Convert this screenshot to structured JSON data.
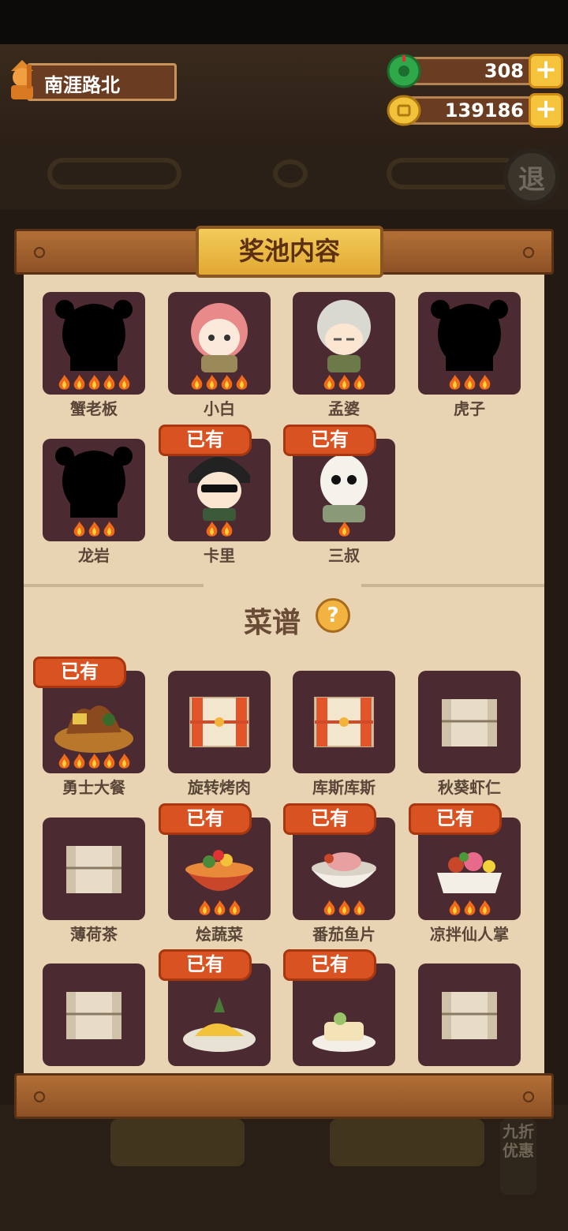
{
  "player": {
    "name": "南涯路北"
  },
  "resources": [
    {
      "icon": "jade-icon",
      "value": "308",
      "color": "#2fa84a"
    },
    {
      "icon": "coin-icon",
      "value": "139186",
      "color": "#f2c23a"
    }
  ],
  "scene": {
    "exit_label": "退",
    "discount_label": "九折优惠"
  },
  "modal": {
    "title": "奖池内容",
    "recipe_section": "菜谱",
    "help_symbol": "?"
  },
  "owned_label": "已有",
  "characters": [
    {
      "name": "蟹老板",
      "owned": false,
      "flames": 5,
      "art": "silhouette-icon"
    },
    {
      "name": "小白",
      "owned": false,
      "flames": 4,
      "art": "girl-portrait-icon"
    },
    {
      "name": "孟婆",
      "owned": false,
      "flames": 3,
      "art": "grandma-portrait-icon"
    },
    {
      "name": "虎子",
      "owned": false,
      "flames": 3,
      "art": "silhouette-icon"
    },
    {
      "name": "龙岩",
      "owned": false,
      "flames": 3,
      "art": "silhouette-icon"
    },
    {
      "name": "卡里",
      "owned": true,
      "flames": 2,
      "art": "sunglasses-boy-icon"
    },
    {
      "name": "三叔",
      "owned": true,
      "flames": 1,
      "art": "uncle-portrait-icon"
    }
  ],
  "recipes": [
    {
      "name": "勇士大餐",
      "owned": true,
      "flames": 5,
      "art": "feast-dish-icon"
    },
    {
      "name": "旋转烤肉",
      "owned": false,
      "flames": 0,
      "art": "scroll-red-icon"
    },
    {
      "name": "库斯库斯",
      "owned": false,
      "flames": 0,
      "art": "scroll-red-icon"
    },
    {
      "name": "秋葵虾仁",
      "owned": false,
      "flames": 0,
      "art": "scroll-plain-icon"
    },
    {
      "name": "薄荷茶",
      "owned": false,
      "flames": 0,
      "art": "scroll-plain-icon"
    },
    {
      "name": "烩蔬菜",
      "owned": true,
      "flames": 3,
      "art": "vegetable-stew-icon"
    },
    {
      "name": "番茄鱼片",
      "owned": true,
      "flames": 3,
      "art": "fish-bowl-icon"
    },
    {
      "name": "凉拌仙人掌",
      "owned": true,
      "flames": 3,
      "art": "salad-dish-icon"
    },
    {
      "name": "",
      "owned": false,
      "flames": 0,
      "art": "scroll-plain-icon"
    },
    {
      "name": "",
      "owned": true,
      "flames": 0,
      "art": "platter-dish-icon"
    },
    {
      "name": "",
      "owned": true,
      "flames": 0,
      "art": "cake-dish-icon"
    },
    {
      "name": "",
      "owned": false,
      "flames": 0,
      "art": "scroll-plain-icon"
    }
  ]
}
